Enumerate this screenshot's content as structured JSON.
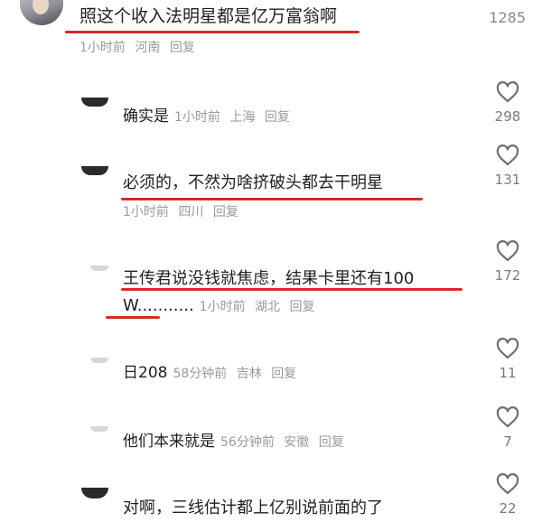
{
  "main_comment": {
    "text": "照这个收入法明星都是亿万富翁啊",
    "time": "1小时前",
    "location": "河南",
    "reply_label": "回复",
    "likes": "1285"
  },
  "replies": [
    {
      "text": "确实是",
      "time": "1小时前",
      "location": "上海",
      "reply_label": "回复",
      "likes": "298"
    },
    {
      "text": "必须的，不然为啥挤破头都去干明星",
      "time": "1小时前",
      "location": "四川",
      "reply_label": "回复",
      "likes": "131"
    },
    {
      "text_line1": "王传君说没钱就焦虑，结果卡里还有100",
      "text_line2": "W...........",
      "time": "1小时前",
      "location": "湖北",
      "reply_label": "回复",
      "likes": "172"
    },
    {
      "text": "日208",
      "time": "58分钟前",
      "location": "吉林",
      "reply_label": "回复",
      "likes": "11"
    },
    {
      "text": "他们本来就是",
      "time": "56分钟前",
      "location": "安徽",
      "reply_label": "回复",
      "likes": "7"
    },
    {
      "text": "对啊，三线估计都上亿别说前面的了",
      "likes": "22"
    }
  ],
  "colors": {
    "annotation_underline": "#d62a2a",
    "meta_text": "#9a9a9a"
  },
  "icons": {
    "like": "heart-outline-icon"
  }
}
